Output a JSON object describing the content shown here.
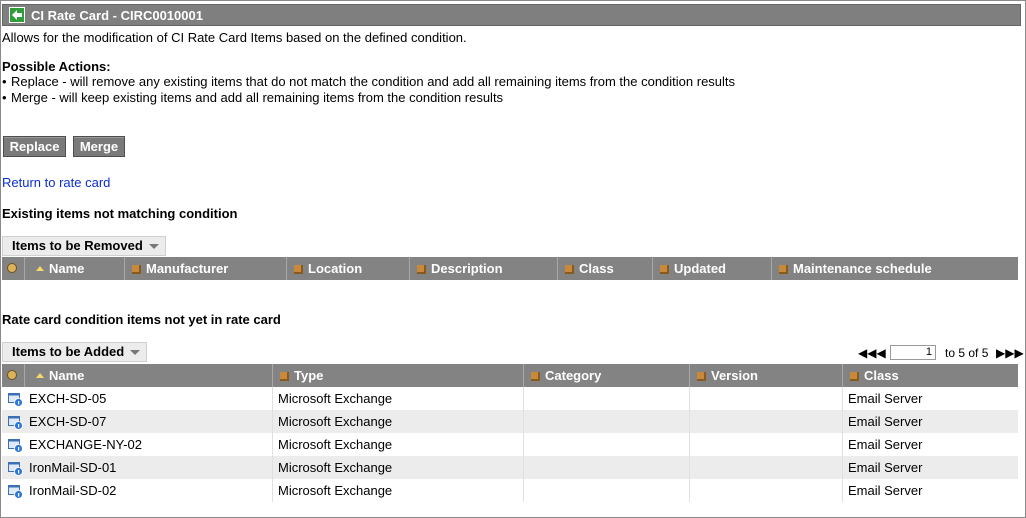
{
  "header": {
    "title": "CI Rate Card - CIRC0010001"
  },
  "description": "Allows for the modification of CI Rate Card Items based on the defined condition.",
  "possible_actions": {
    "heading": "Possible Actions:",
    "items": [
      "Replace - will remove any existing items that do not match the condition and add all remaining items from the condition results",
      "Merge - will keep existing items and add all remaining items from the condition results"
    ]
  },
  "buttons": {
    "replace": "Replace",
    "merge": "Merge"
  },
  "return_link": "Return to rate card",
  "removed_section": {
    "heading": "Existing items not matching condition",
    "list_title": "Items to be Removed",
    "columns": [
      "Name",
      "Manufacturer",
      "Location",
      "Description",
      "Class",
      "Updated",
      "Maintenance schedule"
    ]
  },
  "added_section": {
    "heading": "Rate card condition items not yet in rate card",
    "list_title": "Items to be Added",
    "columns": [
      "Name",
      "Type",
      "Category",
      "Version",
      "Class"
    ],
    "pager": {
      "page": "1",
      "range_text": "to 5 of 5"
    },
    "rows": [
      {
        "name": "EXCH-SD-05",
        "type": "Microsoft Exchange",
        "category": "",
        "version": "",
        "class": "Email Server"
      },
      {
        "name": "EXCH-SD-07",
        "type": "Microsoft Exchange",
        "category": "",
        "version": "",
        "class": "Email Server"
      },
      {
        "name": "EXCHANGE-NY-02",
        "type": "Microsoft Exchange",
        "category": "",
        "version": "",
        "class": "Email Server"
      },
      {
        "name": "IronMail-SD-01",
        "type": "Microsoft Exchange",
        "category": "",
        "version": "",
        "class": "Email Server"
      },
      {
        "name": "IronMail-SD-02",
        "type": "Microsoft Exchange",
        "category": "",
        "version": "",
        "class": "Email Server"
      }
    ]
  },
  "icons": {
    "back": "back-arrow-icon",
    "settings": "gear-icon",
    "sort": "sort-ascending-icon",
    "column": "column-box-icon",
    "row": "server-record-icon",
    "dropdown": "chevron-down-icon",
    "pager_first": "first-page-icon",
    "pager_prev": "previous-page-icon",
    "pager_next": "next-page-icon",
    "pager_last": "last-page-icon"
  },
  "colors": {
    "header_bar": "#7f7f7f",
    "link": "#0a2fd0",
    "row_alt": "#ececec"
  }
}
